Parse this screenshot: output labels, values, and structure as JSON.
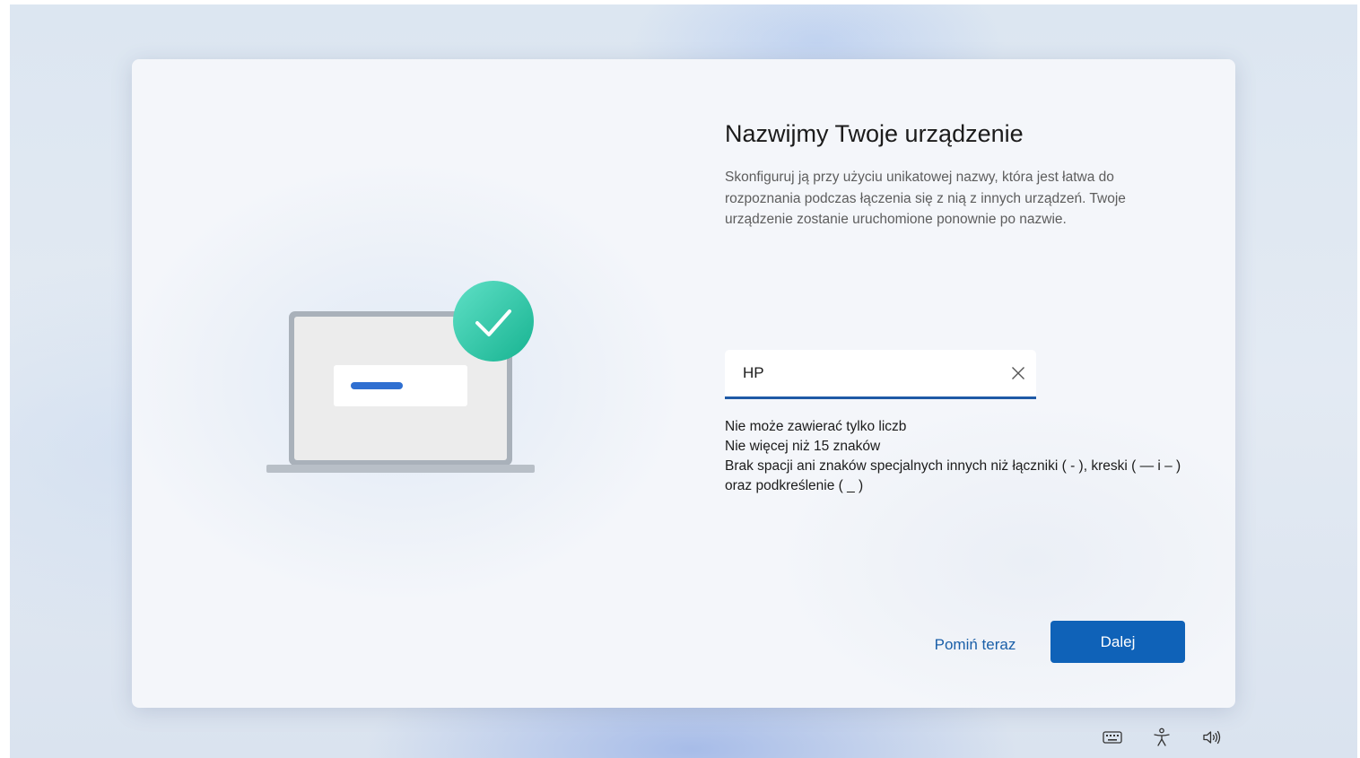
{
  "dialog": {
    "title": "Nazwijmy Twoje urządzenie",
    "description": "Skonfiguruj ją przy użyciu unikatowej nazwy, która jest łatwa do rozpoznania podczas łączenia się z nią z innych urządzeń. Twoje urządzenie zostanie uruchomione ponownie po nazwie.",
    "name_input": {
      "value": "HP"
    },
    "rules": [
      "Nie może zawierać tylko liczb",
      "Nie więcej niż 15 znaków",
      "Brak spacji ani znaków specjalnych innych niż łączniki ( - ), kreski ( — i – ) oraz podkreślenie ( _ )"
    ],
    "skip_label": "Pomiń teraz",
    "next_label": "Dalej"
  },
  "illustration": {
    "icon": "laptop-with-checkmark"
  },
  "tray": {
    "icons": [
      "keyboard-icon",
      "accessibility-icon",
      "volume-icon"
    ]
  },
  "colors": {
    "accent": "#0f62b8",
    "link": "#1a5fa8",
    "check": "#2ec9a7"
  }
}
